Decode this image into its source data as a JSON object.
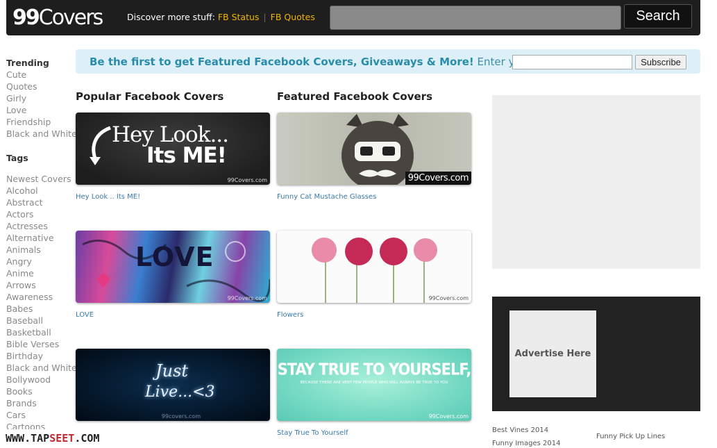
{
  "header": {
    "logo_num": "99",
    "logo_text": "Covers",
    "discover_label": "Discover more stuff:",
    "links": [
      "FB Status",
      "FB Quotes"
    ],
    "search_button": "Search"
  },
  "sidebar": {
    "trending_heading": "Trending",
    "trending": [
      "Cute",
      "Quotes",
      "Girly",
      "Love",
      "Friendship",
      "Black and White"
    ],
    "tags_heading": "Tags",
    "tags": [
      "Newest Covers",
      "Alcohol",
      "Abstract",
      "Actors",
      "Actresses",
      "Alternative",
      "Animals",
      "Angry",
      "Anime",
      "Arrows",
      "Awareness",
      "Babes",
      "Baseball",
      "Basketball",
      "Bible Verses",
      "Birthday",
      "Black and White",
      "Bollywood",
      "Books",
      "Brands",
      "Cars",
      "Cartoons"
    ]
  },
  "subscribe": {
    "bold_text": "Be the first to get Featured Facebook Covers, Giveaways & More!",
    "plain_text": " Enter your email:",
    "button": "Subscribe"
  },
  "popular": {
    "title": "Popular Facebook Covers",
    "items": [
      {
        "caption": "Hey Look .. Its ME!",
        "line1": "Hey Look...",
        "line2": "Its ME!",
        "wm": "99Covers.com"
      },
      {
        "caption": "LOVE",
        "text": "LOVE",
        "wm": "99Covers.com"
      },
      {
        "caption": "",
        "line1": "Just",
        "line2": "Live...<3",
        "wm": "99covers.com"
      }
    ]
  },
  "featured": {
    "title": "Featured Facebook Covers",
    "items": [
      {
        "caption": "Funny Cat Mustache Glasses",
        "wm": "99Covers.com"
      },
      {
        "caption": "Flowers",
        "wm": "99Covers.com"
      },
      {
        "caption": "Stay True To Yourself",
        "line1": "STAY TRUE TO YOURSELF,",
        "line2": "BECAUSE THERE ARE VERY FEW PEOPLE WHO WILL ALWAYS BE TRUE TO YOU",
        "wm": "99Covers.com"
      }
    ]
  },
  "ads": {
    "advertise": "Advertise Here",
    "links": [
      "Best Vines 2014",
      "Funny Images 2014",
      "Funny Pick Up Lines"
    ]
  },
  "watermark": {
    "prefix": "WWW.TAP",
    "mid": "SEET",
    "suffix": ".COM"
  },
  "colors": {
    "accent_link": "#f0b400",
    "caption_link": "#3a7aa7",
    "subscribe_text": "#2a8cab"
  }
}
